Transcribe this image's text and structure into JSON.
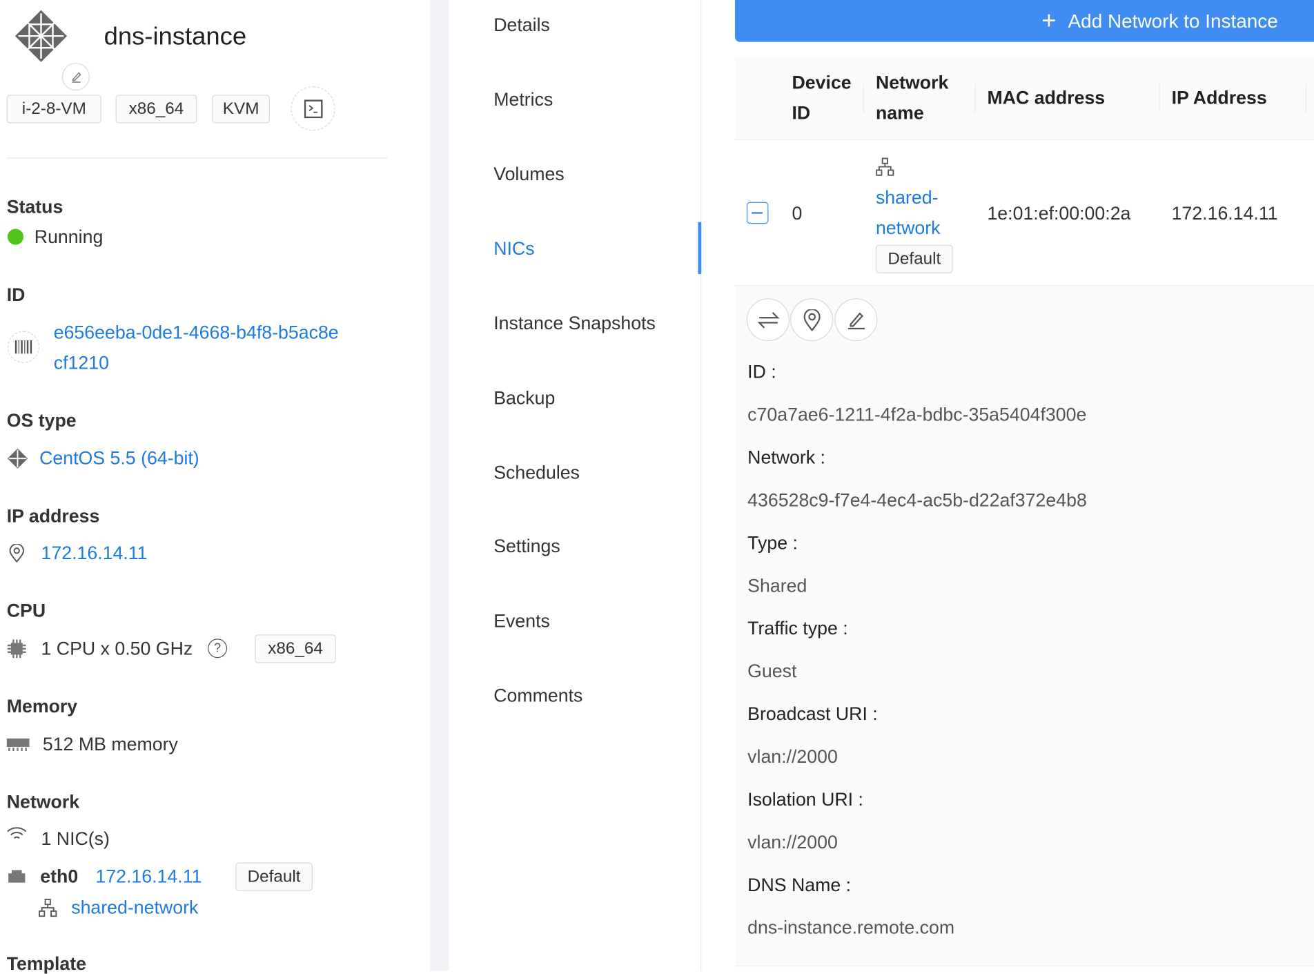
{
  "instance": {
    "name": "dns-instance",
    "tags": [
      "i-2-8-VM",
      "x86_64",
      "KVM"
    ]
  },
  "details": {
    "status_label": "Status",
    "status": "Running",
    "id_label": "ID",
    "id_line1": "e656eeba-0de1-4668-b4f8-b5ac8e",
    "id_line2": "cf1210",
    "os_label": "OS type",
    "os": "CentOS 5.5 (64-bit)",
    "ip_label": "IP address",
    "ip": "172.16.14.11",
    "cpu_label": "CPU",
    "cpu": "1 CPU x 0.50 GHz",
    "cpu_arch": "x86_64",
    "memory_label": "Memory",
    "memory": "512 MB memory",
    "network_label": "Network",
    "nics": "1 NIC(s)",
    "nic_name": "eth0",
    "nic_ip": "172.16.14.11",
    "nic_default": "Default",
    "nic_network": "shared-network",
    "template_label": "Template"
  },
  "tabs": [
    "Details",
    "Metrics",
    "Volumes",
    "NICs",
    "Instance Snapshots",
    "Backup",
    "Schedules",
    "Settings",
    "Events",
    "Comments"
  ],
  "active_tab": "NICs",
  "colors": {
    "accent": "#3f8cf3",
    "link": "#1f7ae0",
    "running": "#52c41a"
  },
  "nics": {
    "add_button": "Add Network to Instance",
    "columns": {
      "device_id_1": "Device",
      "device_id_2": "ID",
      "network_1": "Network",
      "network_2": "name",
      "mac": "MAC address",
      "ip": "IP Address"
    },
    "row": {
      "device_id": "0",
      "network_1": "shared-",
      "network_2": "network",
      "default": "Default",
      "mac": "1e:01:ef:00:00:2a",
      "ip": "172.16.14.11"
    },
    "expanded": [
      {
        "label": "ID :",
        "value": "c70a7ae6-1211-4f2a-bdbc-35a5404f300e"
      },
      {
        "label": "Network :",
        "value": "436528c9-f7e4-4ec4-ac5b-d22af372e4b8"
      },
      {
        "label": "Type :",
        "value": "Shared"
      },
      {
        "label": "Traffic type :",
        "value": "Guest"
      },
      {
        "label": "Broadcast URI :",
        "value": "vlan://2000"
      },
      {
        "label": "Isolation URI :",
        "value": "vlan://2000"
      },
      {
        "label": "DNS Name :",
        "value": "dns-instance.remote.com"
      }
    ]
  }
}
